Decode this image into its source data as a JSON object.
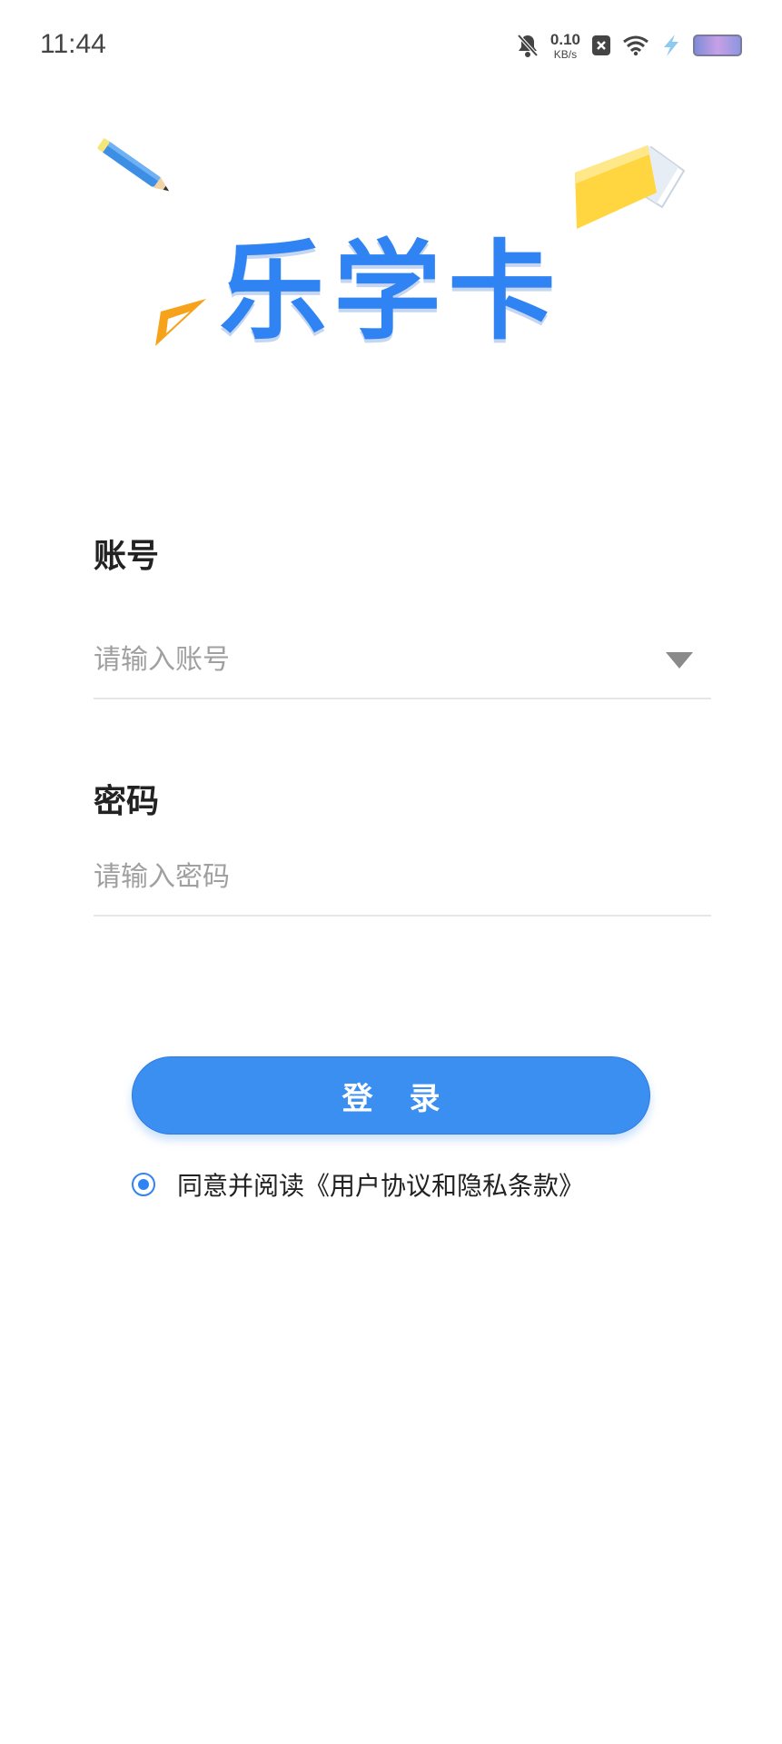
{
  "status_bar": {
    "time": "11:44",
    "net_speed_value": "0.10",
    "net_speed_unit": "KB/s",
    "icons": [
      "mute-bell-icon",
      "close-box-icon",
      "wifi-icon",
      "charging-bolt-icon",
      "battery-icon"
    ]
  },
  "logo": {
    "title": "乐学卡",
    "brand_color": "#2f83f2"
  },
  "account": {
    "label": "账号",
    "placeholder": "请输入账号"
  },
  "password": {
    "label": "密码",
    "placeholder": "请输入密码"
  },
  "login": {
    "label": "登录"
  },
  "agreement": {
    "checked": true,
    "prefix": "同意并阅读",
    "link": "《用户协议和隐私条款》"
  }
}
